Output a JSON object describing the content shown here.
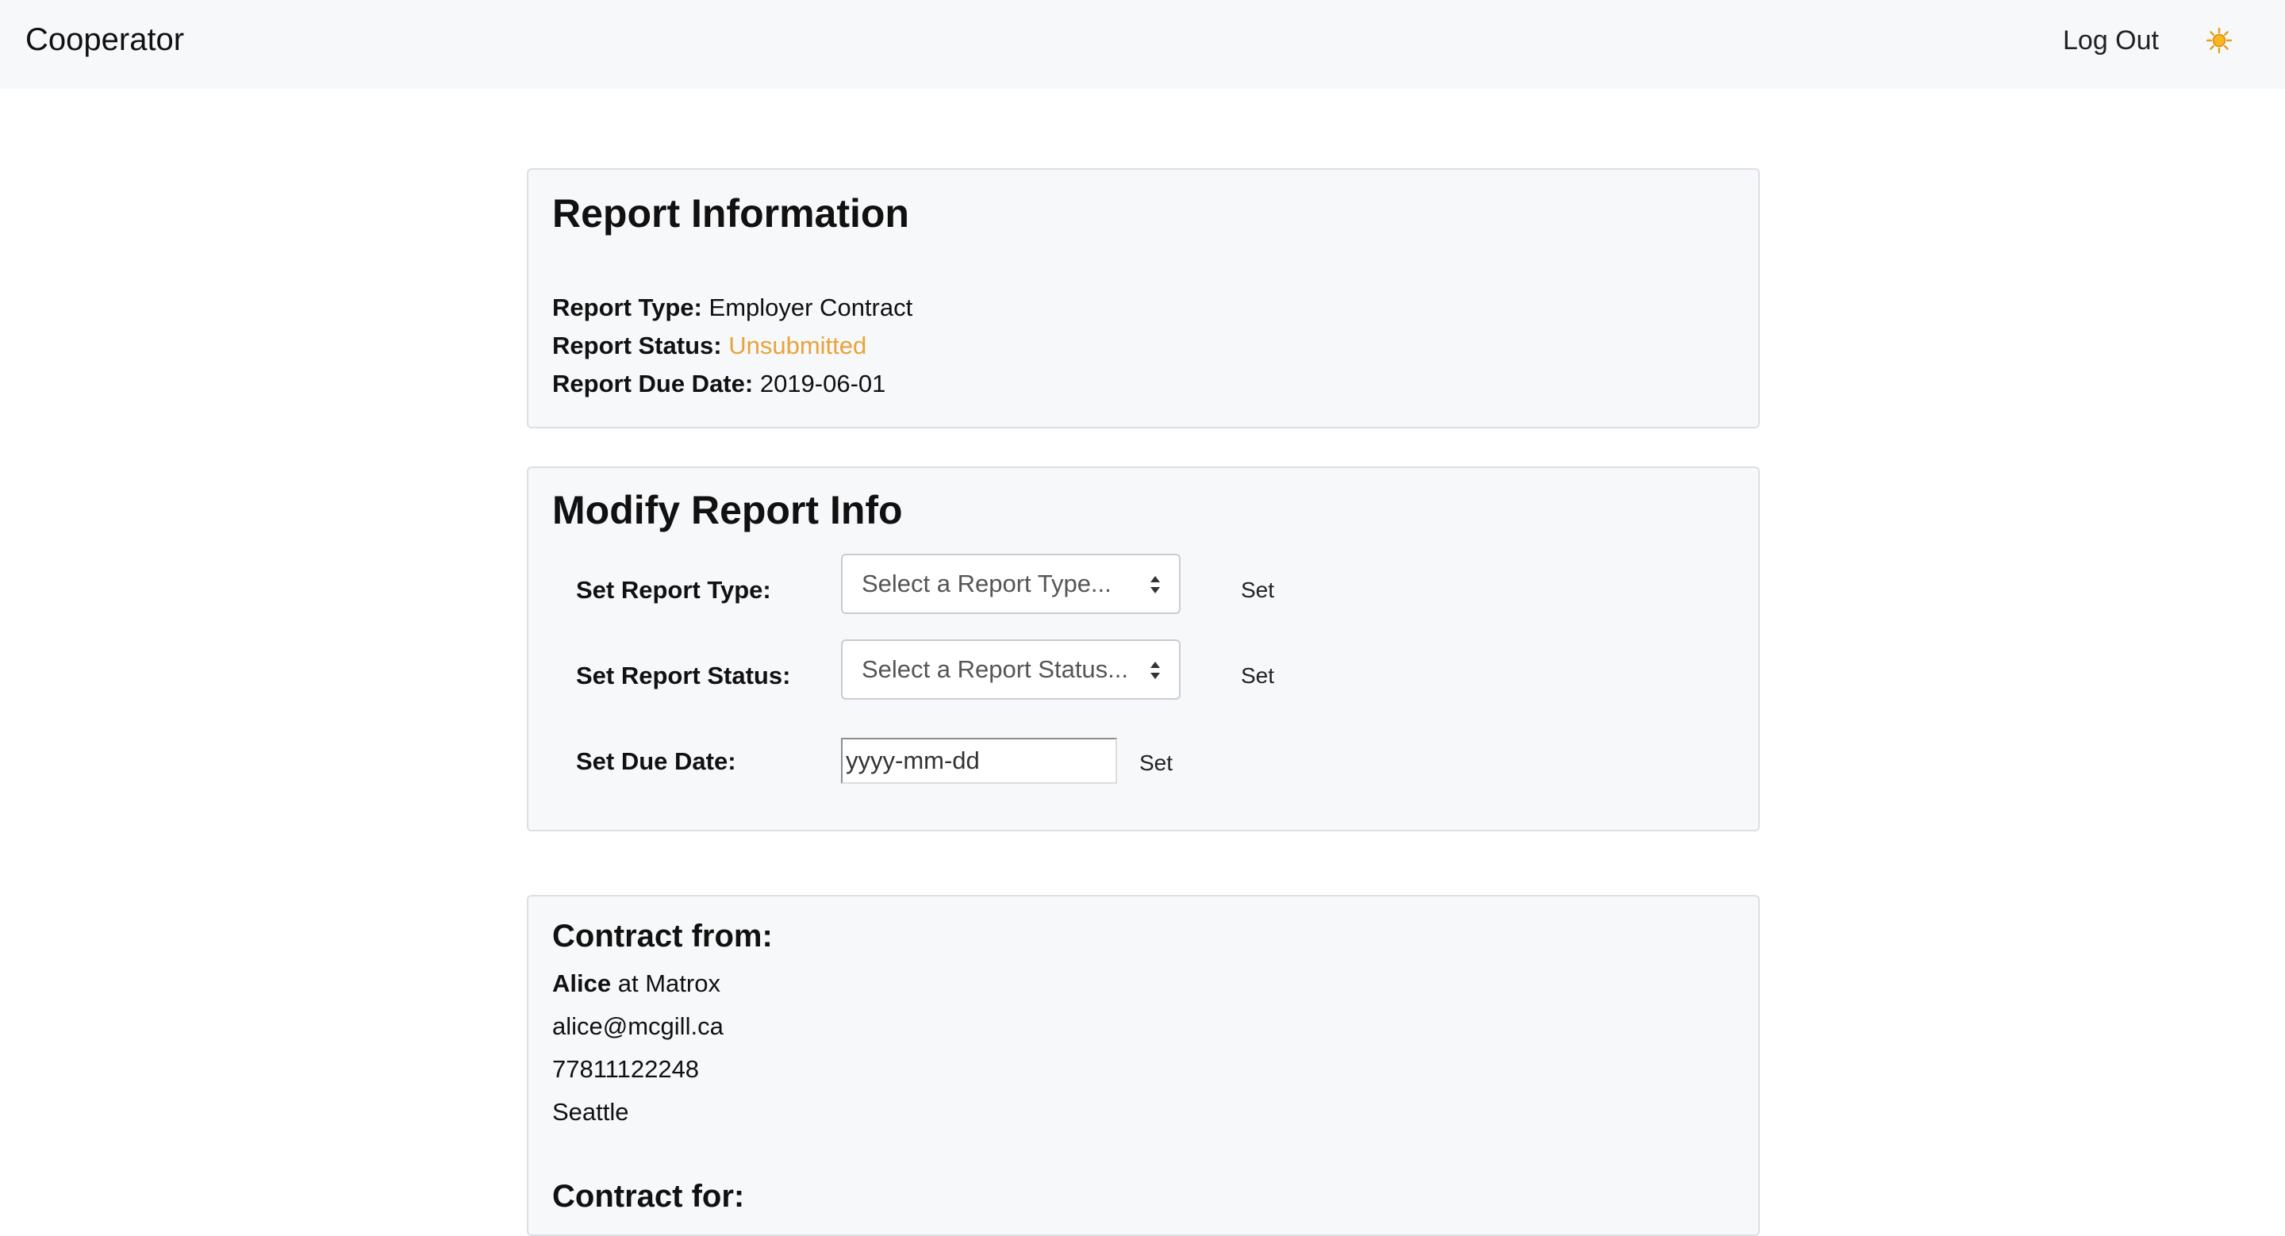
{
  "navbar": {
    "brand": "Cooperator",
    "logout_label": "Log Out",
    "theme_icon": "sun-icon"
  },
  "report_info": {
    "title": "Report Information",
    "type_label": "Report Type:",
    "type_value": "Employer Contract",
    "status_label": "Report Status:",
    "status_value": "Unsubmitted",
    "status_color": "#eaa23a",
    "due_label": "Report Due Date:",
    "due_value": "2019-06-01"
  },
  "modify": {
    "title": "Modify Report Info",
    "type_label": "Set Report Type:",
    "type_select": "Select a Report Type...",
    "status_label": "Set Report Status:",
    "status_select": "Select a Report Status...",
    "due_label": "Set Due Date:",
    "due_placeholder": "yyyy-mm-dd",
    "set_label": "Set"
  },
  "contract": {
    "from_heading": "Contract from:",
    "name": "Alice",
    "at_word": " at ",
    "company": "Matrox",
    "email": "alice@mcgill.ca",
    "phone": "77811122248",
    "city": "Seattle",
    "for_heading": "Contract for:"
  }
}
